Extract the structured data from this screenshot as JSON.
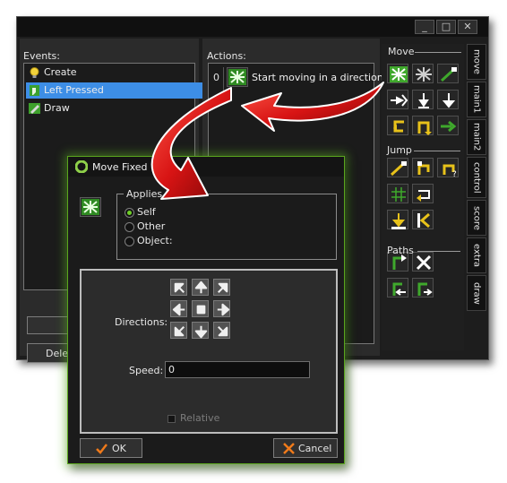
{
  "window": {
    "controls": {
      "minimize": "_",
      "maximize": "□",
      "close": "✕"
    }
  },
  "events": {
    "label": "Events:",
    "items": [
      {
        "name": "Create",
        "icon": "bulb-icon",
        "selected": false
      },
      {
        "name": "Left Pressed",
        "icon": "mouse-icon",
        "selected": true
      },
      {
        "name": "Draw",
        "icon": "draw-icon",
        "selected": false
      }
    ],
    "delete_label": "Dele"
  },
  "actions": {
    "label": "Actions:",
    "items": [
      {
        "index": "0",
        "text": "Start moving in a direction",
        "icon": "move-fixed-icon"
      }
    ]
  },
  "library": {
    "sections": {
      "move": "Move",
      "jump": "Jump",
      "paths": "Paths"
    },
    "tabs": [
      "move",
      "main1",
      "main2",
      "control",
      "score",
      "extra",
      "draw"
    ],
    "active_tab": "move"
  },
  "dialog": {
    "title": "Move Fixed",
    "applies_to": {
      "label": "Applies to",
      "options": [
        "Self",
        "Other",
        "Object:"
      ],
      "selected": "Self"
    },
    "directions_label": "Directions:",
    "speed_label": "Speed:",
    "speed_value": "0",
    "relative_label": "Relative",
    "relative_checked": false,
    "ok_label": "OK",
    "cancel_label": "Cancel"
  },
  "colors": {
    "selection": "#3d8ee6",
    "accent_green": "#5aa51e",
    "arrow_red": "#d01818",
    "icon_green": "#3ea02c"
  }
}
